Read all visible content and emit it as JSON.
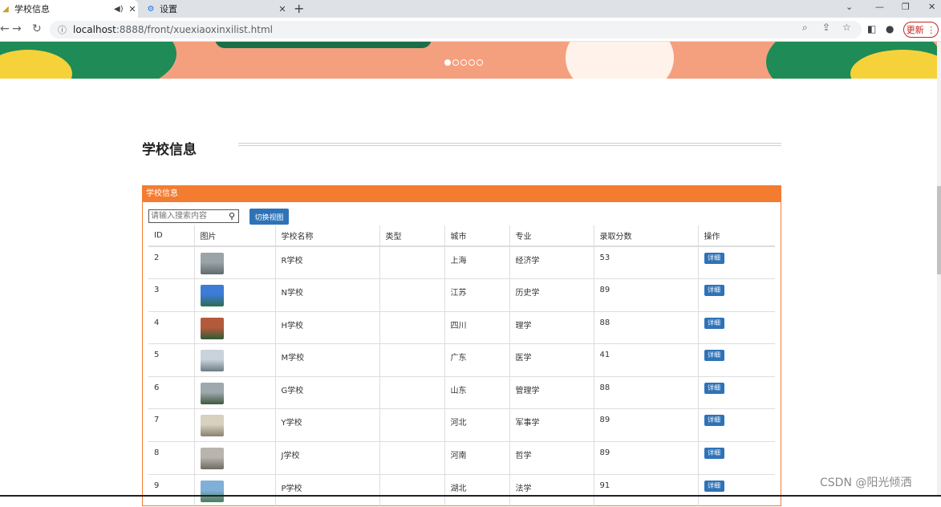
{
  "browser": {
    "tabs": [
      {
        "title": "学校信息",
        "active": true
      },
      {
        "title": "设置",
        "active": false
      }
    ],
    "url_host": "localhost",
    "url_path": ":8888/front/xuexiaoxinxilist.html",
    "update_label": "更新"
  },
  "banner": {
    "slide_count": 5,
    "active_slide": 1
  },
  "page": {
    "section_title": "学校信息",
    "panel_title": "学校信息",
    "search_placeholder": "请输入搜索内容",
    "switch_view_label": "切换视图"
  },
  "table": {
    "headers": [
      "ID",
      "图片",
      "学校名称",
      "类型",
      "城市",
      "专业",
      "录取分数",
      "操作"
    ],
    "rows": [
      {
        "id": "2",
        "name": "R学校",
        "type": "",
        "city": "上海",
        "major": "经济学",
        "score": "53",
        "action": "详细",
        "img_colors": [
          "#9aa3a6",
          "#5e6a6e"
        ]
      },
      {
        "id": "3",
        "name": "N学校",
        "type": "",
        "city": "江苏",
        "major": "历史学",
        "score": "89",
        "action": "详细",
        "img_colors": [
          "#3d7bd6",
          "#2d6e4e"
        ]
      },
      {
        "id": "4",
        "name": "H学校",
        "type": "",
        "city": "四川",
        "major": "理学",
        "score": "88",
        "action": "详细",
        "img_colors": [
          "#b45a3c",
          "#2f5a35"
        ]
      },
      {
        "id": "5",
        "name": "M学校",
        "type": "",
        "city": "广东",
        "major": "医学",
        "score": "41",
        "action": "详细",
        "img_colors": [
          "#c9d3dc",
          "#6b7c86"
        ]
      },
      {
        "id": "6",
        "name": "G学校",
        "type": "",
        "city": "山东",
        "major": "管理学",
        "score": "88",
        "action": "详细",
        "img_colors": [
          "#9fa8ad",
          "#3e5a3f"
        ]
      },
      {
        "id": "7",
        "name": "Y学校",
        "type": "",
        "city": "河北",
        "major": "军事学",
        "score": "89",
        "action": "详细",
        "img_colors": [
          "#d8d0c0",
          "#8a8270"
        ]
      },
      {
        "id": "8",
        "name": "J学校",
        "type": "",
        "city": "河南",
        "major": "哲学",
        "score": "89",
        "action": "详细",
        "img_colors": [
          "#b8b4ae",
          "#6f6a63"
        ]
      },
      {
        "id": "9",
        "name": "P学校",
        "type": "",
        "city": "湖北",
        "major": "法学",
        "score": "91",
        "action": "详细",
        "img_colors": [
          "#7fb0d9",
          "#4e7e55"
        ]
      }
    ]
  },
  "watermark": "CSDN @阳光倾洒",
  "colors": {
    "accent": "#f47c30",
    "button": "#2f73b7"
  }
}
